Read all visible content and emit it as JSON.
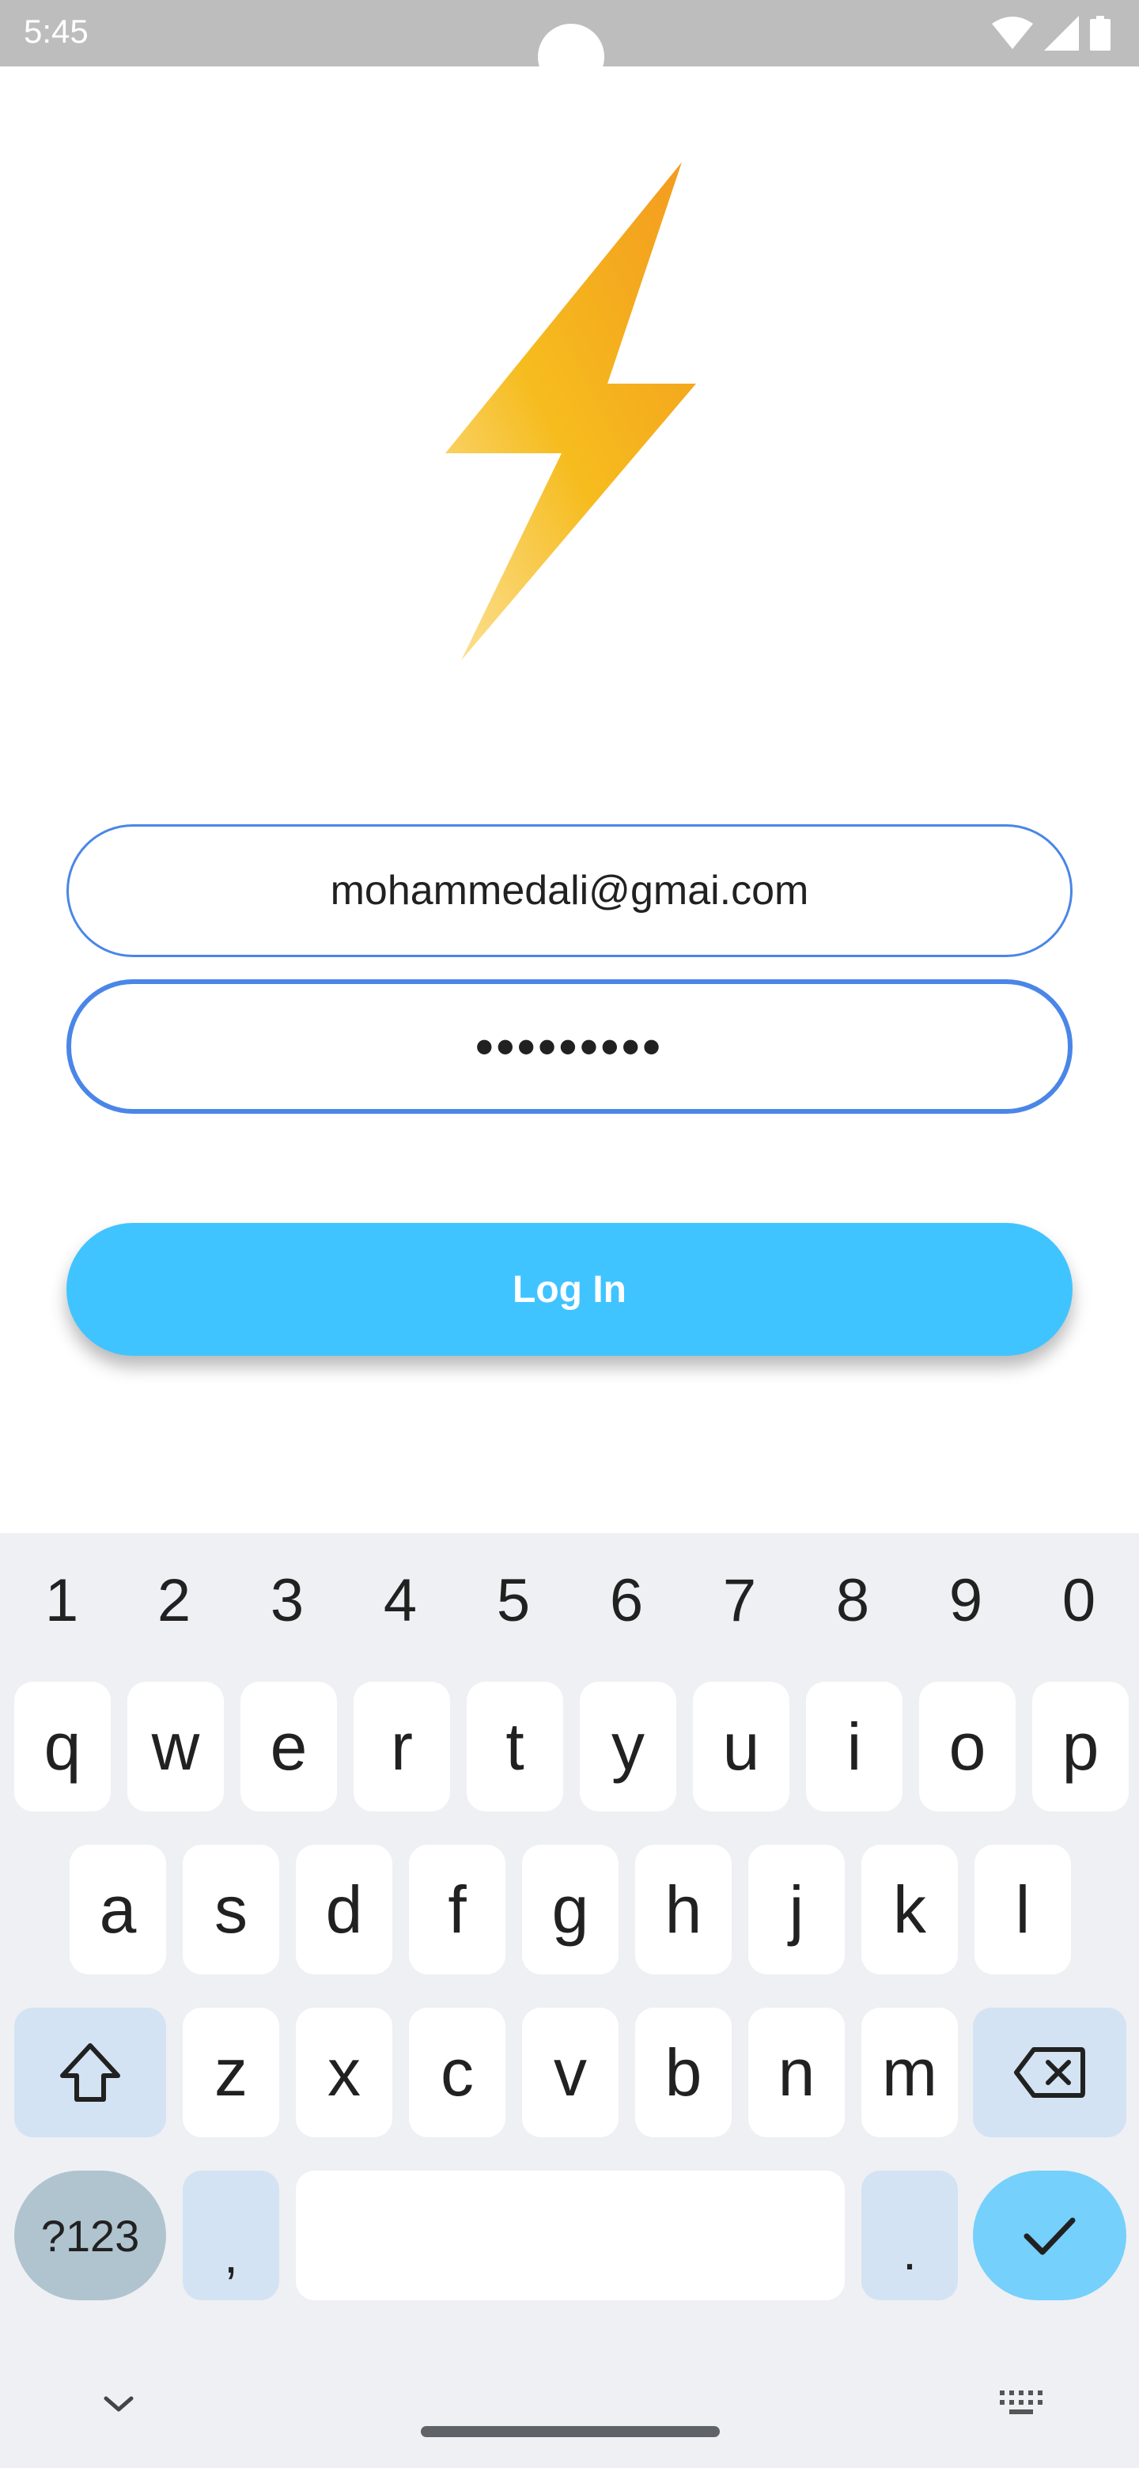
{
  "status_bar": {
    "time": "5:45"
  },
  "login": {
    "email_value": "mohammedali@gmai.com",
    "password_value": "•••••••••",
    "button_label": "Log In"
  },
  "keyboard": {
    "numbers": [
      "1",
      "2",
      "3",
      "4",
      "5",
      "6",
      "7",
      "8",
      "9",
      "0"
    ],
    "row1": [
      "q",
      "w",
      "e",
      "r",
      "t",
      "y",
      "u",
      "i",
      "o",
      "p"
    ],
    "row2": [
      "a",
      "s",
      "d",
      "f",
      "g",
      "h",
      "j",
      "k",
      "l"
    ],
    "row3": [
      "z",
      "x",
      "c",
      "v",
      "b",
      "n",
      "m"
    ],
    "symbols_label": "?123",
    "comma_label": ",",
    "period_label": "."
  },
  "colors": {
    "accent": "#40c4ff",
    "field_border": "#4a86e8",
    "bolt": "#f5a623"
  }
}
